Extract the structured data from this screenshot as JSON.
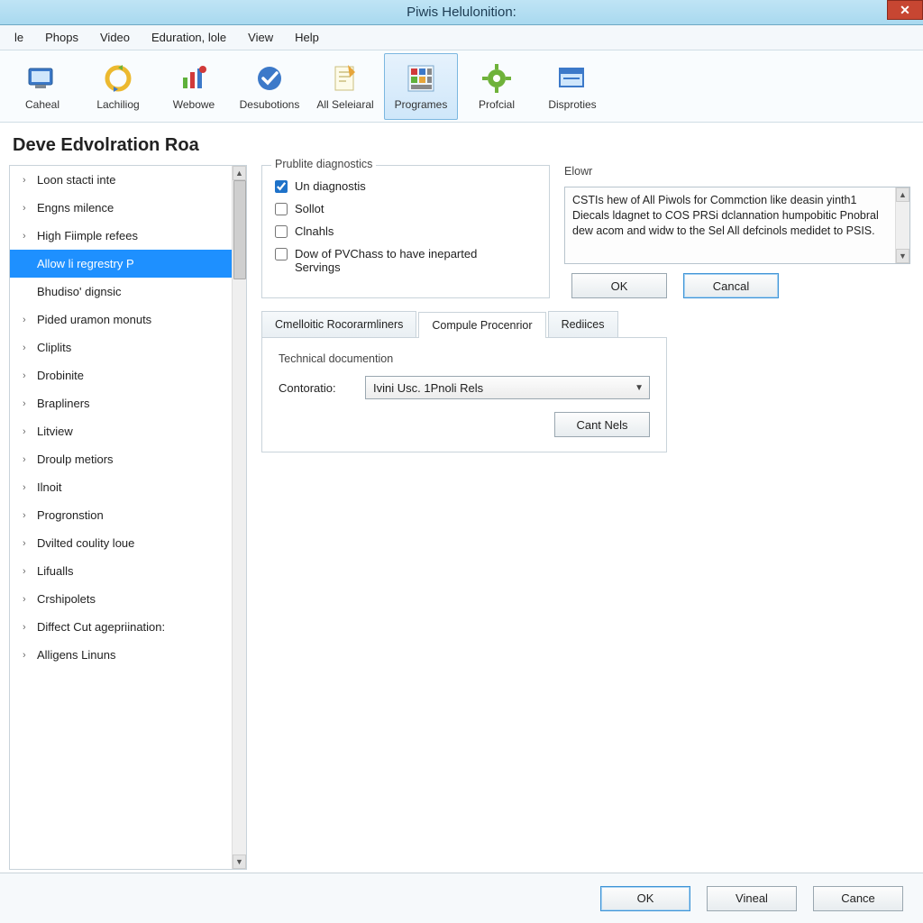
{
  "window": {
    "title": "Piwis Helulonition:"
  },
  "menu": [
    "le",
    "Phops",
    "Video",
    "Eduration, lole",
    "View",
    "Help"
  ],
  "toolbar": [
    {
      "label": "Caheal",
      "icon": "screen"
    },
    {
      "label": "Lachiliog",
      "icon": "refresh"
    },
    {
      "label": "Webowe",
      "icon": "chart"
    },
    {
      "label": "Desubotions",
      "icon": "check"
    },
    {
      "label": "All Seleiaral",
      "icon": "note"
    },
    {
      "label": "Programes",
      "icon": "grid",
      "selected": true
    },
    {
      "label": "Profcial",
      "icon": "gear"
    },
    {
      "label": "Disproties",
      "icon": "window"
    }
  ],
  "page_heading": "Deve Edvolration Roa",
  "sidebar": [
    {
      "label": "Loon stacti inte",
      "chev": true
    },
    {
      "label": "Engns milence",
      "chev": true
    },
    {
      "label": "High Fiimple refees",
      "chev": true
    },
    {
      "label": "Allow li regrestry P",
      "chev": false,
      "selected": true
    },
    {
      "label": "Bhudiso' dignsic",
      "chev": false
    },
    {
      "label": "Pided uramon monuts",
      "chev": true
    },
    {
      "label": "Cliplits",
      "chev": true
    },
    {
      "label": "Drobinite",
      "chev": true
    },
    {
      "label": "Brapliners",
      "chev": true
    },
    {
      "label": "Litview",
      "chev": true
    },
    {
      "label": "Droulp metiors",
      "chev": true
    },
    {
      "label": "Ilnoit",
      "chev": true
    },
    {
      "label": "Progronstion",
      "chev": true
    },
    {
      "label": "Dvilted coulity loue",
      "chev": true
    },
    {
      "label": "Lifualls",
      "chev": true
    },
    {
      "label": "Crshipolets",
      "chev": true
    },
    {
      "label": "Diffect Cut agepriination:",
      "chev": true
    },
    {
      "label": "Alligens Linuns",
      "chev": true
    }
  ],
  "diagnostics": {
    "legend": "Prublite diagnostics",
    "items": [
      {
        "label": "Un diagnostis",
        "checked": true
      },
      {
        "label": "Sollot",
        "checked": false
      },
      {
        "label": "Clnahls",
        "checked": false
      },
      {
        "label": "Dow of PVChass to have ineparted Servings",
        "checked": false
      }
    ]
  },
  "info": {
    "label": "Elowr",
    "text": "CSTIs hew of All Piwols for Commction like deasin yinth1 Diecals ldagnet to COS PRSi dclannation humpobitic Pnobral dew acom and widw to the Sel All defcinols medidet to PSIS.",
    "ok": "OK",
    "cancel": "Cancal"
  },
  "tabs": {
    "items": [
      "Cmelloitic Rocorarmliners",
      "Compule Procenrior",
      "Rediices"
    ],
    "activeIndex": 1,
    "section_legend": "Technical documention",
    "form_label": "Contoratio:",
    "combo_value": "Ivini Usc. 1Pnoli Rels",
    "apply": "Cant Nels"
  },
  "footer": {
    "ok": "OK",
    "mid": "Vineal",
    "cancel": "Cance"
  }
}
